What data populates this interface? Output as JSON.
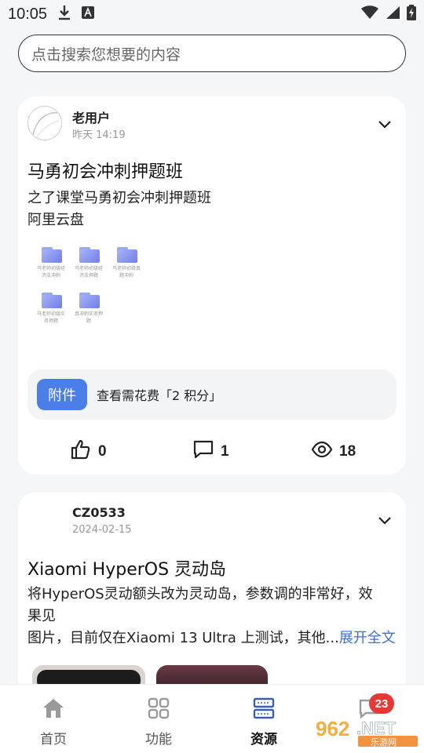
{
  "status": {
    "time": "10:05"
  },
  "search": {
    "placeholder": "点击搜索您想要的内容"
  },
  "posts": [
    {
      "author": "老用户",
      "time": "昨天 14:19",
      "title": "马勇初会冲刺押题班",
      "desc_line1": "之了课堂马勇初会冲刺押题班",
      "desc_line2": "阿里云盘",
      "files": [
        {
          "name": "马老师初级经济法冲刺"
        },
        {
          "name": "马老师初级经济法押题"
        },
        {
          "name": "马老师初级真题冲刺"
        },
        {
          "name": "马老师初级实务押题"
        },
        {
          "name": "真冲刺实务押题"
        }
      ],
      "attachment_tag": "附件",
      "attachment_text": "查看需花费「2 积分」",
      "likes": "0",
      "comments": "1",
      "views": "18"
    },
    {
      "author": "CZ0533",
      "time": "2024-02-15",
      "title": "Xiaomi HyperOS 灵动岛",
      "desc_line1": "将HyperOS灵动额头改为灵动岛，参数调的非常好，效",
      "desc_line2": "果见",
      "desc_line3": "图片，目前仅在Xiaomi 13 Ultra 上测试，其他...",
      "expand": "展开全文"
    }
  ],
  "nav": {
    "items": [
      {
        "label": "首页",
        "icon": "home-icon"
      },
      {
        "label": "功能",
        "icon": "grid-icon"
      },
      {
        "label": "资源",
        "icon": "server-icon"
      },
      {
        "label": "",
        "icon": "message-icon"
      }
    ],
    "badge": "23"
  },
  "watermark": {
    "text": "962.NET",
    "sub": "乐游网"
  },
  "colors": {
    "accent": "#4a7ee8",
    "link": "#3d6fd6",
    "badge": "#e53935"
  }
}
